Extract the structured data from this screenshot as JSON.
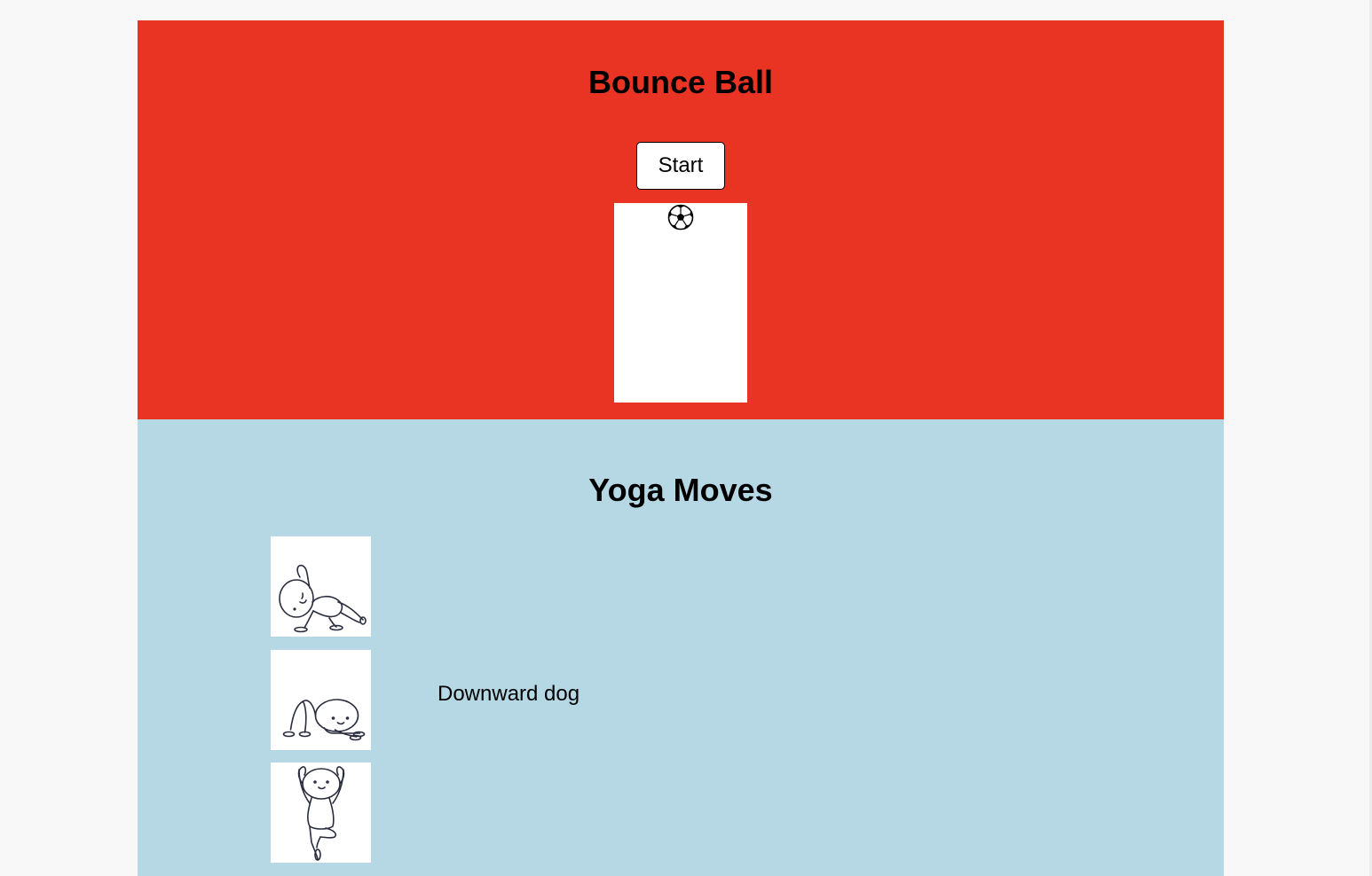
{
  "bounce": {
    "title": "Bounce Ball",
    "start_label": "Start",
    "ball_icon": "soccer-ball-icon",
    "background": "#e93424"
  },
  "yoga": {
    "title": "Yoga Moves",
    "background": "#b5d8e4",
    "poses": [
      {
        "icon": "side-plank-pose-icon",
        "label": ""
      },
      {
        "icon": "downward-dog-pose-icon",
        "label": "Downward dog"
      },
      {
        "icon": "tree-pose-icon",
        "label": ""
      }
    ]
  }
}
